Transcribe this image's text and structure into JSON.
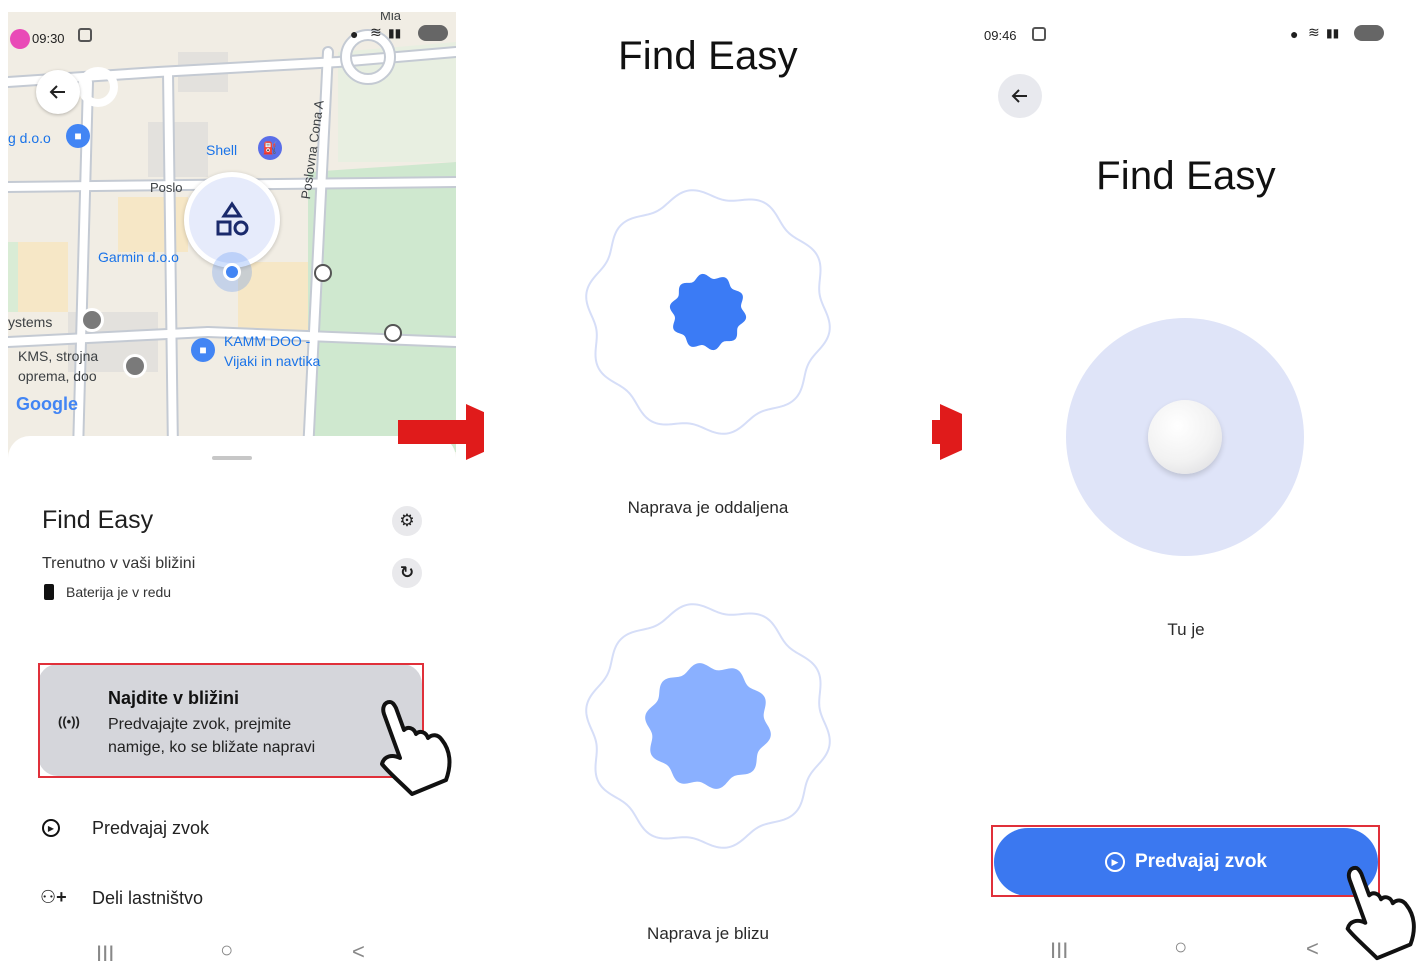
{
  "panel1": {
    "status_time": "09:30",
    "map": {
      "labels": {
        "business_left": "g d.o.o",
        "shell": "Shell",
        "poslov": "Poslo",
        "street": "Poslovna Cona A",
        "garmin": "Garmin d.o.o",
        "systems": "ystems",
        "kms_line1": "KMS, strojna",
        "kms_line2": "oprema, doo",
        "kamm_line1": "KAMM DOO -",
        "kamm_line2": "Vijaki in navtika",
        "mia": "Mia",
        "google": "Google"
      }
    },
    "sheet": {
      "title": "Find Easy",
      "subtitle": "Trenutno v vaši bližini",
      "battery": "Baterija je v redu",
      "nearby_title": "Najdite v bližini",
      "nearby_desc_line1": "Predvajajte zvok, prejmite",
      "nearby_desc_line2": "namige, ko se bližate napravi",
      "play_sound": "Predvajaj zvok",
      "share_ownership": "Deli lastništvo"
    }
  },
  "panel2": {
    "title": "Find Easy",
    "far_text": "Naprava je oddaljena",
    "near_text": "Naprava je blizu"
  },
  "panel3": {
    "status_time": "09:46",
    "title": "Find Easy",
    "found_text": "Tu je",
    "play_button": "Predvajaj zvok"
  },
  "nav": {
    "recent": "III",
    "home": "○",
    "back": "<"
  },
  "colors": {
    "accent_blue": "#3b78f0",
    "dot_far": "#3b7bf5",
    "dot_near": "#8ab0ff",
    "found_circle": "#dfe4f8",
    "highlight_red": "#e0303a",
    "arrow_red": "#e01b1b"
  }
}
